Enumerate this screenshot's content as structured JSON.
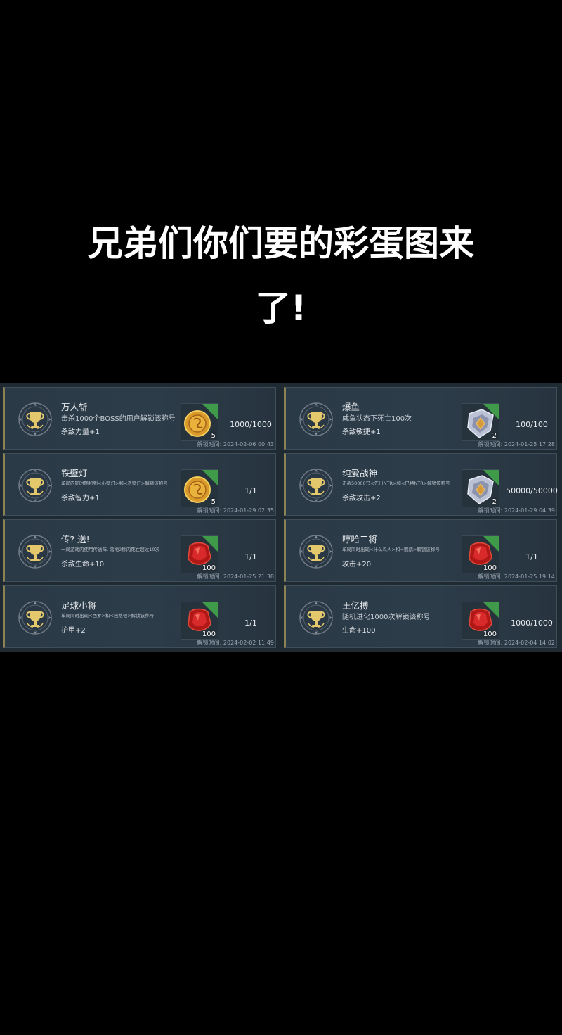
{
  "headline": {
    "line1": "兄弟们你们要的彩蛋图来",
    "line2": "了!"
  },
  "time_label": "解锁时间:",
  "cards": [
    {
      "title": "万人斩",
      "desc": "击杀1000个BOSS的用户解锁该称号",
      "reward": "杀敌力量+1",
      "qty": "5",
      "progress": "1000/1000",
      "time": "2024-02-06 00:43",
      "item": "gold-coin",
      "tiny": false
    },
    {
      "title": "爆鱼",
      "desc": "咸鱼状态下死亡100次",
      "reward": "杀敌敏捷+1",
      "qty": "2",
      "progress": "100/100",
      "time": "2024-01-25 17:28",
      "item": "silver-shield",
      "tiny": false
    },
    {
      "title": "铁壁灯",
      "desc": "单局内同时随机到<小壁灯>和<老壁灯>解锁该称号",
      "reward": "杀敌智力+1",
      "qty": "5",
      "progress": "1/1",
      "time": "2024-01-29 02:35",
      "item": "gold-coin",
      "tiny": true
    },
    {
      "title": "纯爱战神",
      "desc": "击杀50000只<先出NTR>和<巴特NTR>解锁该称号",
      "reward": "杀敌攻击+2",
      "qty": "2",
      "progress": "50000/50000",
      "time": "2024-01-29 04:39",
      "item": "silver-shield",
      "tiny": true
    },
    {
      "title": "传? 送!",
      "desc": "一局游戏内使用传送阵, 落地2秒内死亡超过10次",
      "reward": "杀敌生命+10",
      "qty": "100",
      "progress": "1/1",
      "time": "2024-01-25 21:38",
      "item": "red-gem",
      "tiny": true
    },
    {
      "title": "哼哈二将",
      "desc": "单局同时出现<什么鸟人>和<鹦鹉>解锁该称号",
      "reward": "攻击+20",
      "qty": "100",
      "progress": "1/1",
      "time": "2024-01-25 19:14",
      "item": "red-gem",
      "tiny": true
    },
    {
      "title": "足球小将",
      "desc": "单局同时出现<西罗>和<巴格顿>解锁该称号",
      "reward": "护甲+2",
      "qty": "100",
      "progress": "1/1",
      "time": "2024-02-02 11:49",
      "item": "red-gem",
      "tiny": true
    },
    {
      "title": "王亿搏",
      "desc": "随机进化1000次解锁该称号",
      "reward": "生命+100",
      "qty": "100",
      "progress": "1000/1000",
      "time": "2024-02-04 14:02",
      "item": "red-gem",
      "tiny": false
    }
  ]
}
